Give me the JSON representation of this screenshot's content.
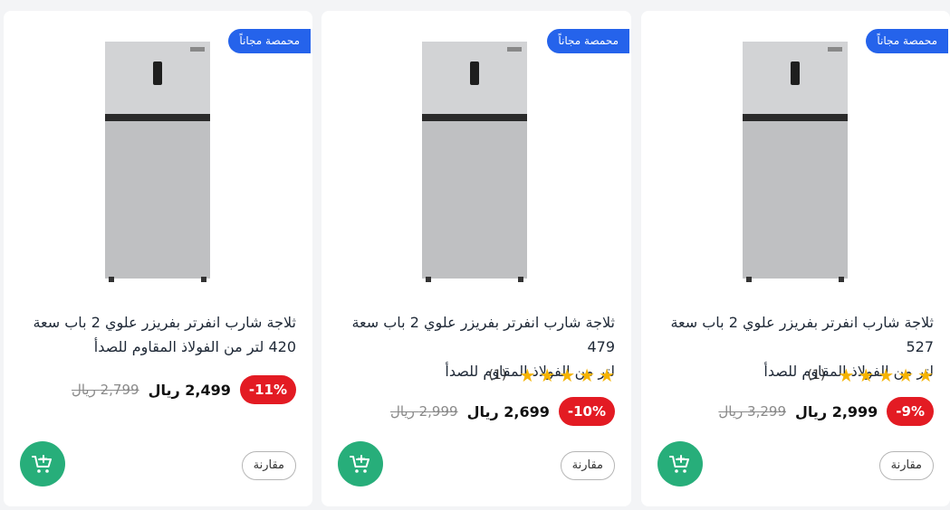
{
  "products": [
    {
      "badge": "محمصة مجاناً",
      "title_line1": "ثلاجة شارب انفرتر بفريزر علوي 2 باب سعة",
      "title_line2": "420 لتر من الفولاذ المقاوم للصدأ",
      "discount": "-11%",
      "price": "2,499 ريال",
      "old_price": "2,799 ريال",
      "compare_label": "مقارنة",
      "cart_icon": "add-to-cart-icon"
    },
    {
      "badge": "محمصة مجاناً",
      "title_line1": "ثلاجة شارب انفرتر بفريزر علوي 2 باب سعة 479",
      "title_line2": "لتر من الفولاذ المقاوم للصدأ",
      "rating_stars": 5,
      "rating_count": "(1)",
      "discount": "-10%",
      "price": "2,699 ريال",
      "old_price": "2,999 ريال",
      "compare_label": "مقارنة",
      "cart_icon": "add-to-cart-icon"
    },
    {
      "badge": "محمصة مجاناً",
      "title_line1": "ثلاجة شارب انفرتر بفريزر علوي 2 باب سعة 527",
      "title_line2": "لتر من الفولاذ المقاوم للصدأ",
      "rating_stars": 5,
      "rating_count": "(1)",
      "discount": "-9%",
      "price": "2,999 ريال",
      "old_price": "3,299 ريال",
      "compare_label": "مقارنة",
      "cart_icon": "add-to-cart-icon"
    }
  ],
  "colors": {
    "badge": "#2563eb",
    "discount": "#e31b23",
    "cart": "#27ae7a",
    "star": "#f5b301"
  }
}
